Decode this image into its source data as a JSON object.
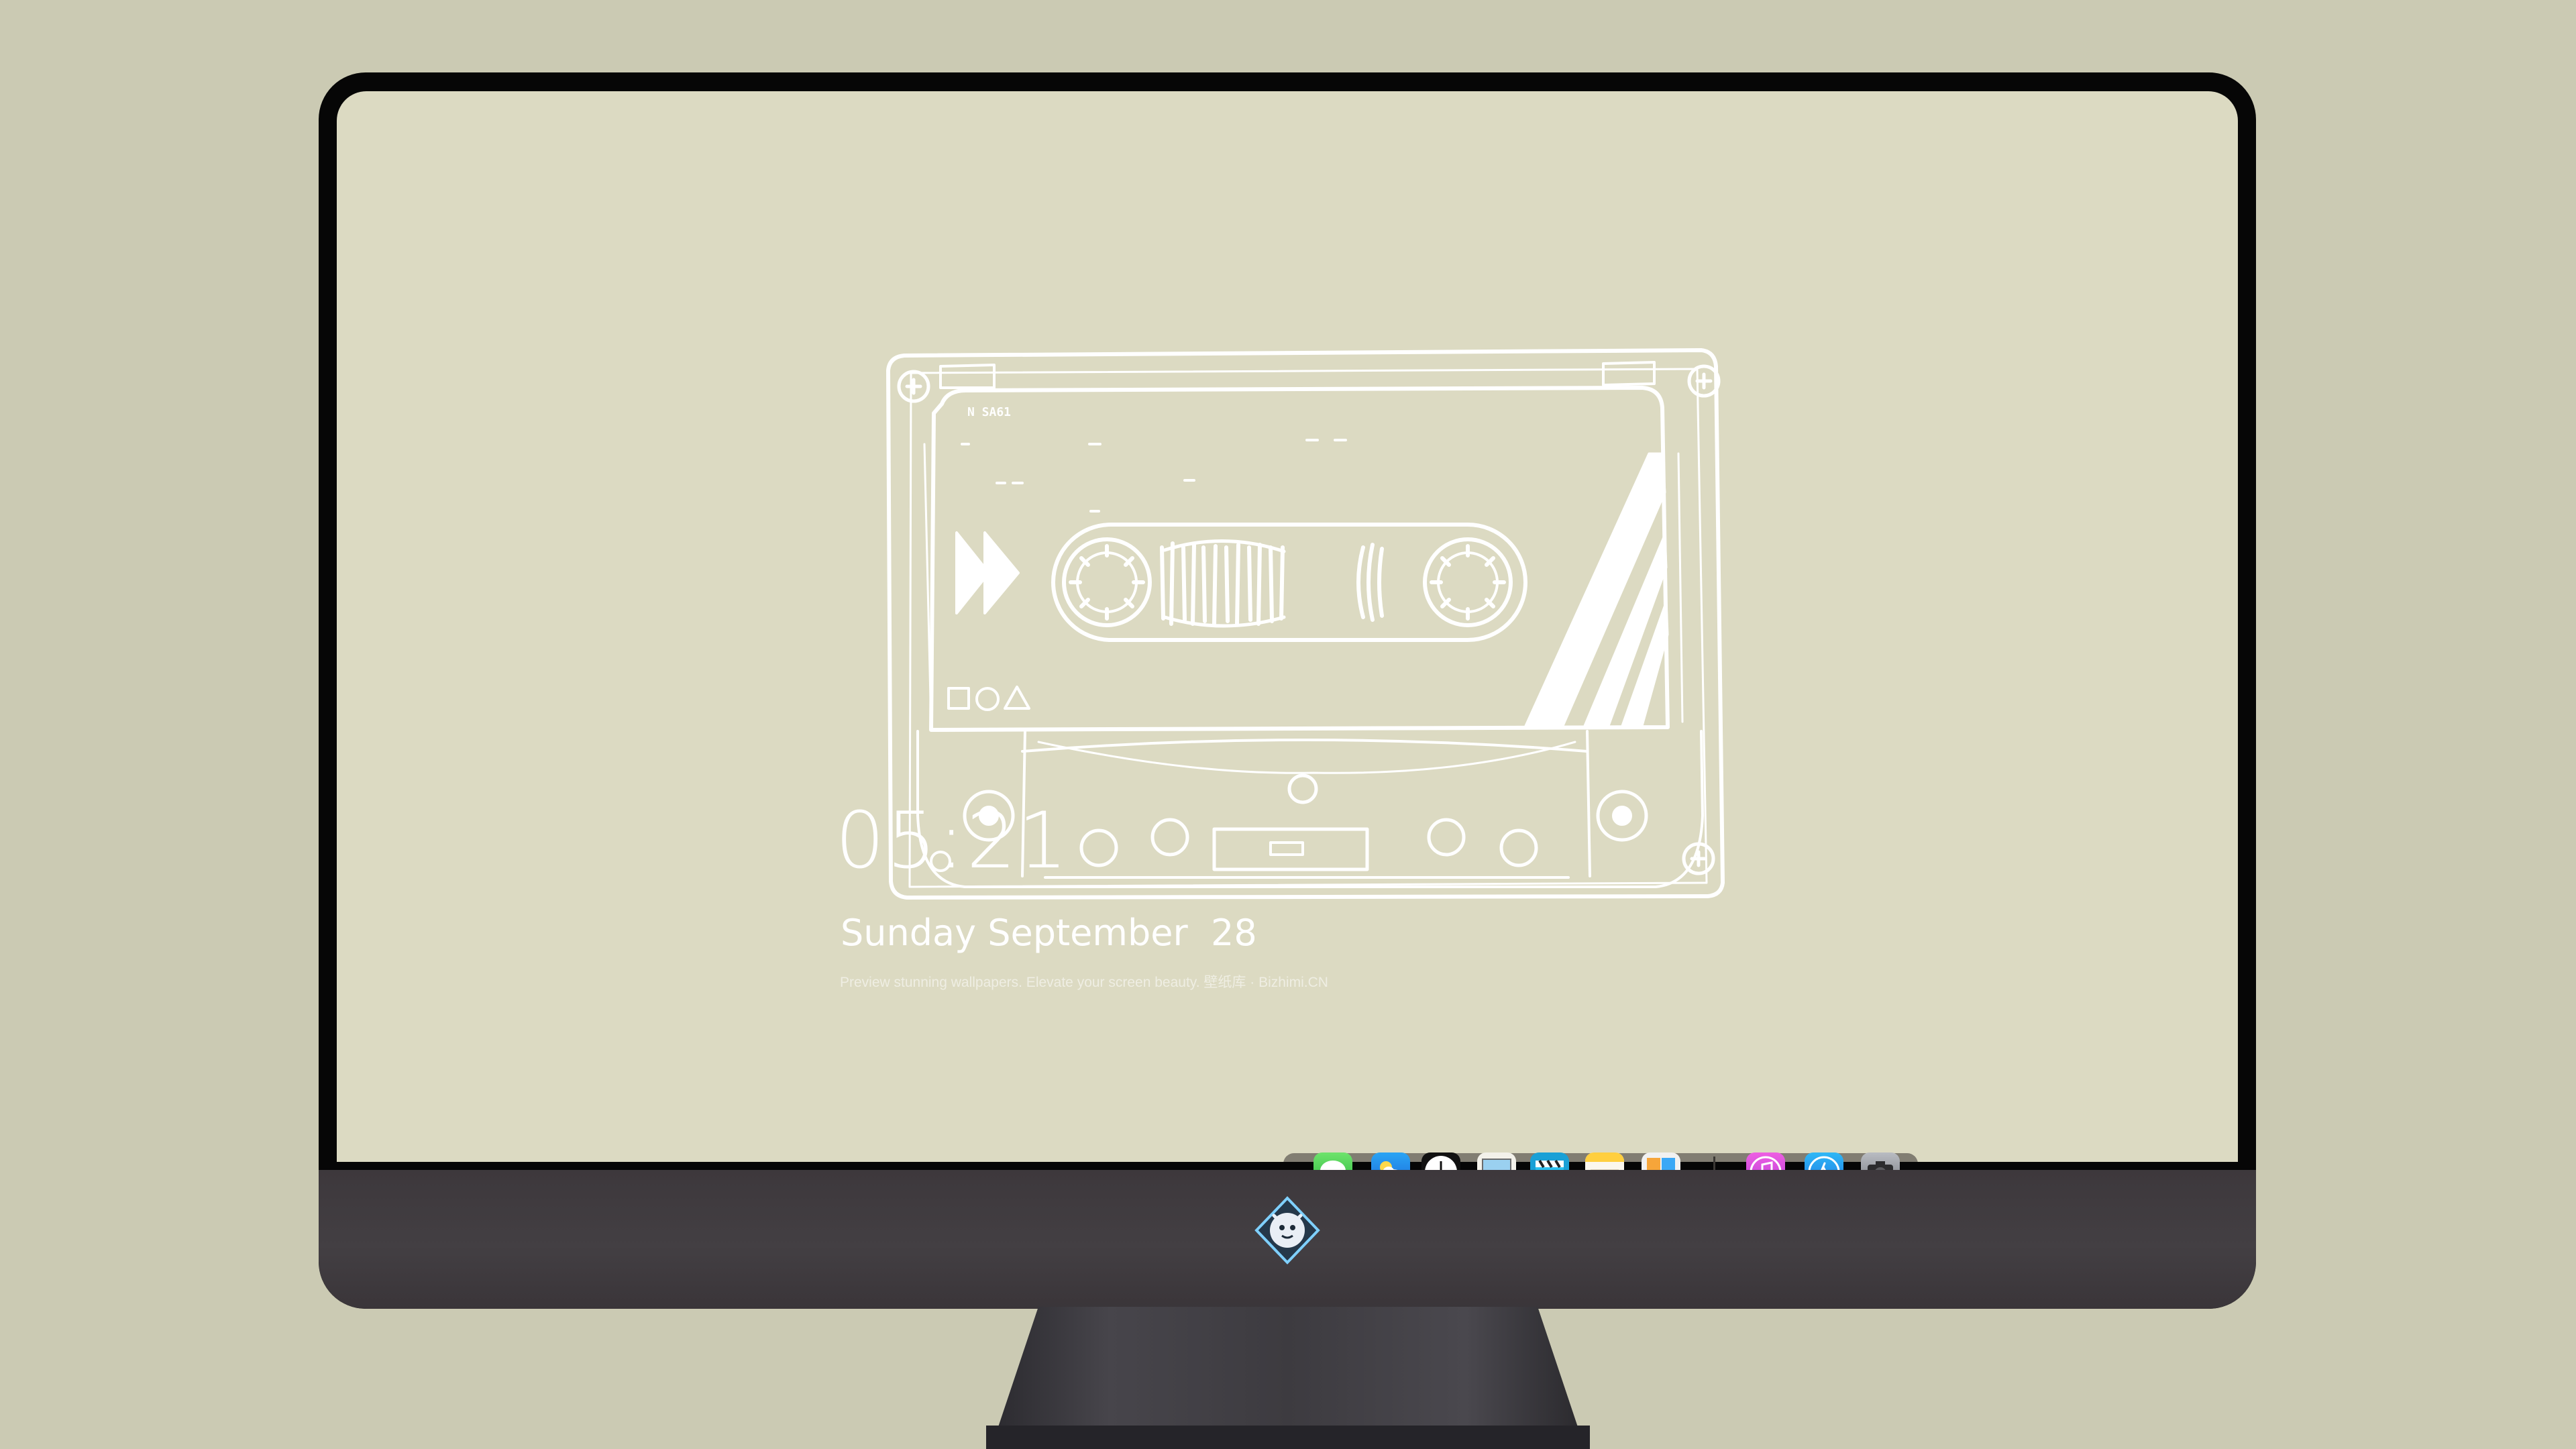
{
  "lockscreen": {
    "time": "05:21",
    "date": "Sunday September  28",
    "tagline": "Preview stunning wallpapers. Elevate your screen beauty. 壁纸库 · Bizhimi.CN"
  },
  "wallpaper": {
    "cassette_label": "N  SA61"
  },
  "dock": {
    "apps": [
      {
        "name": "Messages",
        "icon": "messages-icon"
      },
      {
        "name": "Weather",
        "icon": "weather-icon"
      },
      {
        "name": "Clock",
        "icon": "clock-icon"
      },
      {
        "name": "Preview",
        "icon": "preview-icon"
      },
      {
        "name": "Video",
        "icon": "video-clapper-icon"
      },
      {
        "name": "Notes",
        "icon": "notes-icon"
      },
      {
        "name": "Photos",
        "icon": "photos-icon"
      },
      {
        "name": "Music",
        "icon": "music-icon"
      },
      {
        "name": "App Store",
        "icon": "app-store-icon"
      },
      {
        "name": "Camera",
        "icon": "camera-icon"
      }
    ]
  },
  "colors": {
    "background": "#cbcab3",
    "screen": "#dcdac2",
    "bezel": "#060606",
    "chin": "#403b3f",
    "dock": "#6c6860",
    "text": "#ffffff"
  }
}
